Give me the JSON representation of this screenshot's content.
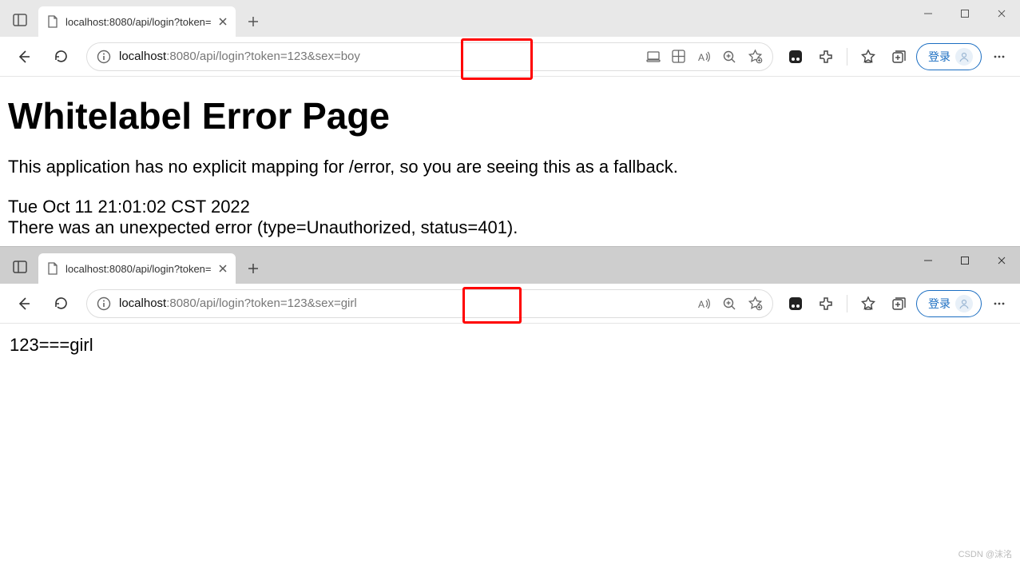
{
  "window1": {
    "tab": {
      "title": "localhost:8080/api/login?token="
    },
    "url": {
      "host": "localhost",
      "rest": ":8080/api/login?token=123&sex=boy"
    },
    "login_label": "登录",
    "content": {
      "heading": "Whitelabel Error Page",
      "message": "This application has no explicit mapping for /error, so you are seeing this as a fallback.",
      "timestamp": "Tue Oct 11 21:01:02 CST 2022",
      "detail": "There was an unexpected error (type=Unauthorized, status=401)."
    }
  },
  "window2": {
    "tab": {
      "title": "localhost:8080/api/login?token="
    },
    "url": {
      "host": "localhost",
      "rest": ":8080/api/login?token=123&sex=girl"
    },
    "login_label": "登录",
    "content": {
      "body": "123===girl"
    }
  },
  "watermark": "CSDN @沫洺"
}
